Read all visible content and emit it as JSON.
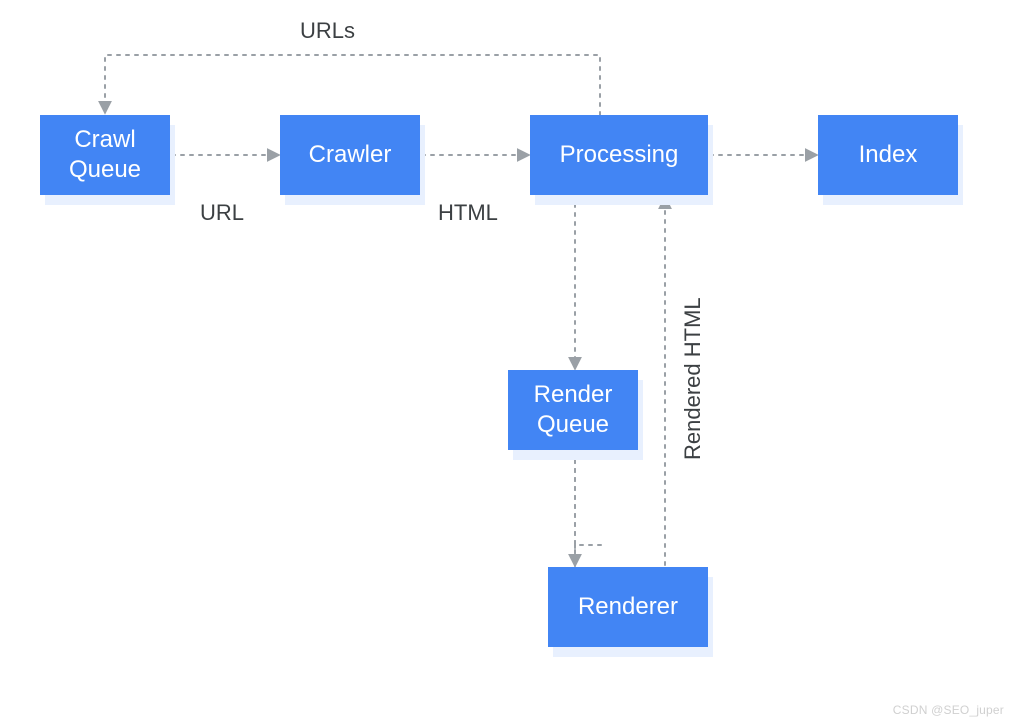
{
  "diagram": {
    "nodes": {
      "crawl_queue": "Crawl\nQueue",
      "crawler": "Crawler",
      "processing": "Processing",
      "index": "Index",
      "render_queue": "Render\nQueue",
      "renderer": "Renderer"
    },
    "edges": {
      "urls_back": "URLs",
      "url": "URL",
      "html": "HTML",
      "rendered_html": "Rendered HTML"
    },
    "colors": {
      "node_fill": "#4285f4",
      "node_shadow": "#e8f0fe",
      "connector": "#9aa0a6",
      "text": "#3c4043"
    }
  },
  "watermark": "CSDN @SEO_juper"
}
